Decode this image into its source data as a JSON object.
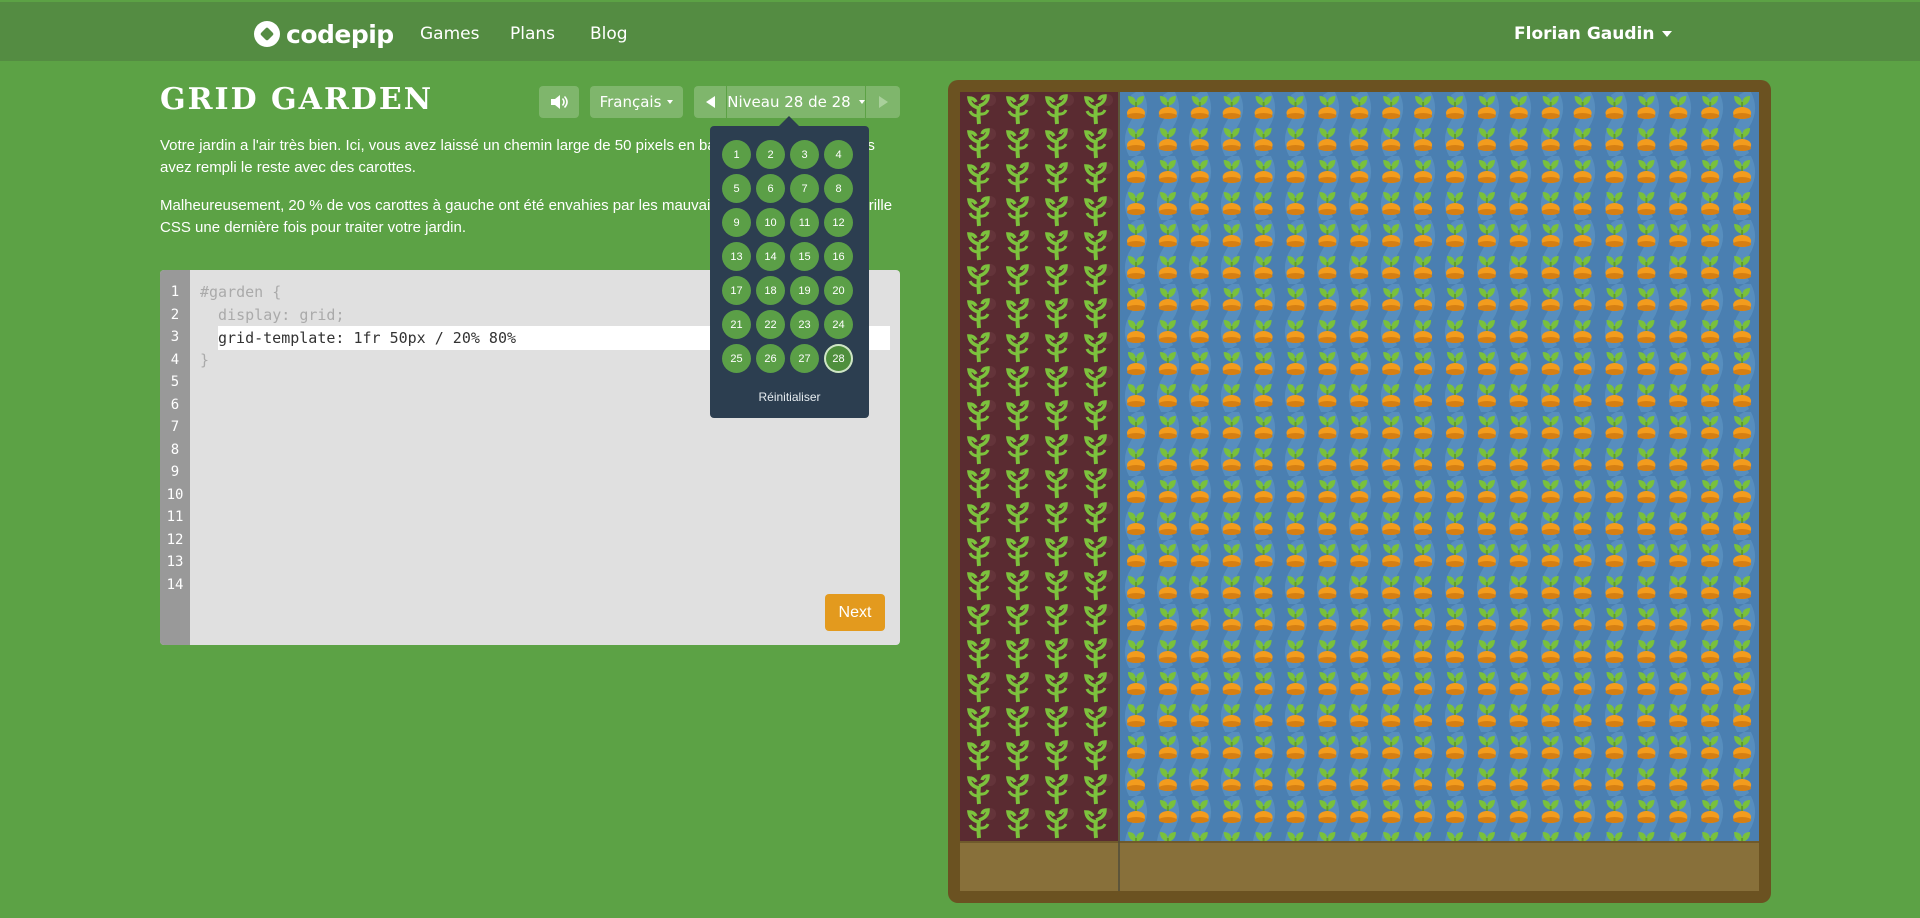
{
  "nav": {
    "logo_text": "codepip",
    "games": "Games",
    "plans": "Plans",
    "blog": "Blog",
    "user": "Florian Gaudin"
  },
  "header": {
    "title": "GRID GARDEN",
    "language": "Français",
    "level_label": "Niveau 28 de 28"
  },
  "instructions": [
    "Votre jardin a l'air très bien. Ici, vous avez laissé un chemin large de 50 pixels en bas de votre jardin et vous avez rempli le reste avec des carottes.",
    "Malheureusement, 20 % de vos carottes à gauche ont été envahies par les mauvaises herbes. Utilisez la grille CSS une dernière fois pour traiter votre jardin."
  ],
  "editor": {
    "line_numbers": [
      "1",
      "2",
      "3",
      "4",
      "5",
      "6",
      "7",
      "8",
      "9",
      "10",
      "11",
      "12",
      "13",
      "14"
    ],
    "line1": "#garden {",
    "line2": "  display: grid;",
    "input_value": "grid-template: 1fr 50px / 20% 80%",
    "line4": "}",
    "submit_label": "Next"
  },
  "level_menu": {
    "levels": [
      "1",
      "2",
      "3",
      "4",
      "5",
      "6",
      "7",
      "8",
      "9",
      "10",
      "11",
      "12",
      "13",
      "14",
      "15",
      "16",
      "17",
      "18",
      "19",
      "20",
      "21",
      "22",
      "23",
      "24",
      "25",
      "26",
      "27",
      "28"
    ],
    "current": "28",
    "reset_label": "Réinitialiser"
  },
  "icons": {
    "sound": "speaker-icon",
    "prev": "arrow-left-icon",
    "next": "arrow-right-icon",
    "logo": "codepip-logo-icon"
  },
  "colors": {
    "background": "#5ca245",
    "topbar": "#548c42",
    "button": "#7fb66c",
    "popover": "#2c3e50",
    "submit": "#e39a1e",
    "weeds": "#5a2b31",
    "water": "#4a7fb1",
    "dirt": "#88703a"
  }
}
